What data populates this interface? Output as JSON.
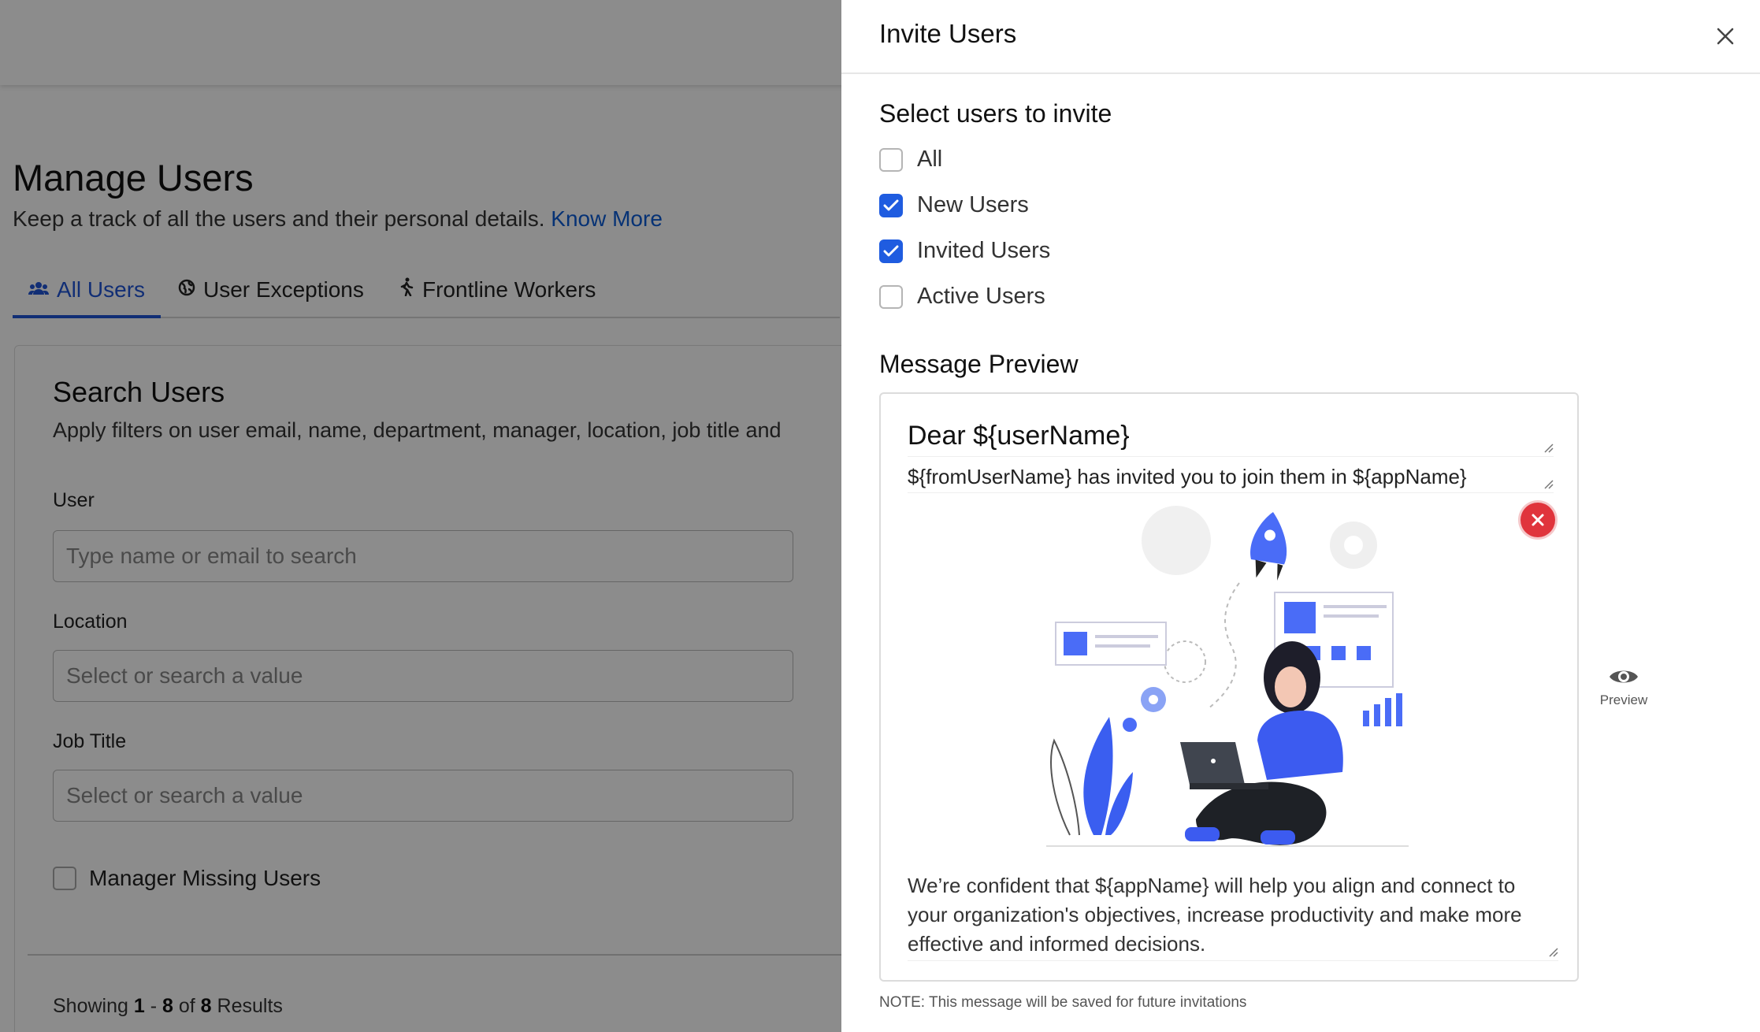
{
  "background": {
    "page_title": "Manage Users",
    "page_subtitle": "Keep a track of all the users and their personal details.",
    "know_more_link": "Know More",
    "tabs": [
      {
        "label": "All Users",
        "icon": "users-icon",
        "active": true
      },
      {
        "label": "User Exceptions",
        "icon": "globe-icon",
        "active": false
      },
      {
        "label": "Frontline Workers",
        "icon": "walking-icon",
        "active": false
      }
    ],
    "search_card": {
      "title": "Search Users",
      "description": "Apply filters on user email, name, department, manager, location, job title and",
      "user_label": "User",
      "user_placeholder": "Type name or email to search",
      "location_label": "Location",
      "location_placeholder": "Select or search a value",
      "job_title_label": "Job Title",
      "job_title_placeholder": "Select or search a value",
      "manager_missing_label": "Manager Missing Users",
      "showing_prefix": "Showing",
      "showing_from": "1",
      "showing_sep": "-",
      "showing_to": "8",
      "showing_of": "of",
      "showing_total": "8",
      "showing_suffix": "Results"
    }
  },
  "drawer": {
    "title": "Invite Users",
    "select_section_title": "Select users to invite",
    "options": [
      {
        "label": "All",
        "checked": false
      },
      {
        "label": "New Users",
        "checked": true
      },
      {
        "label": "Invited Users",
        "checked": true
      },
      {
        "label": "Active Users",
        "checked": false
      }
    ],
    "message_section_title": "Message Preview",
    "message": {
      "greeting": "Dear ${userName}",
      "intro": "${fromUserName} has invited you to join them in ${appName}",
      "body": "We’re confident that ${appName} will help you align and connect to your organization's objectives, increase productivity and make more effective and informed decisions."
    },
    "preview_label": "Preview",
    "note": "NOTE: This message will be saved for future invitations"
  },
  "colors": {
    "accent": "#1f5ce0",
    "link": "#0b5cd5",
    "danger": "#e0343c",
    "illustration_blue": "#4a6cf7"
  }
}
